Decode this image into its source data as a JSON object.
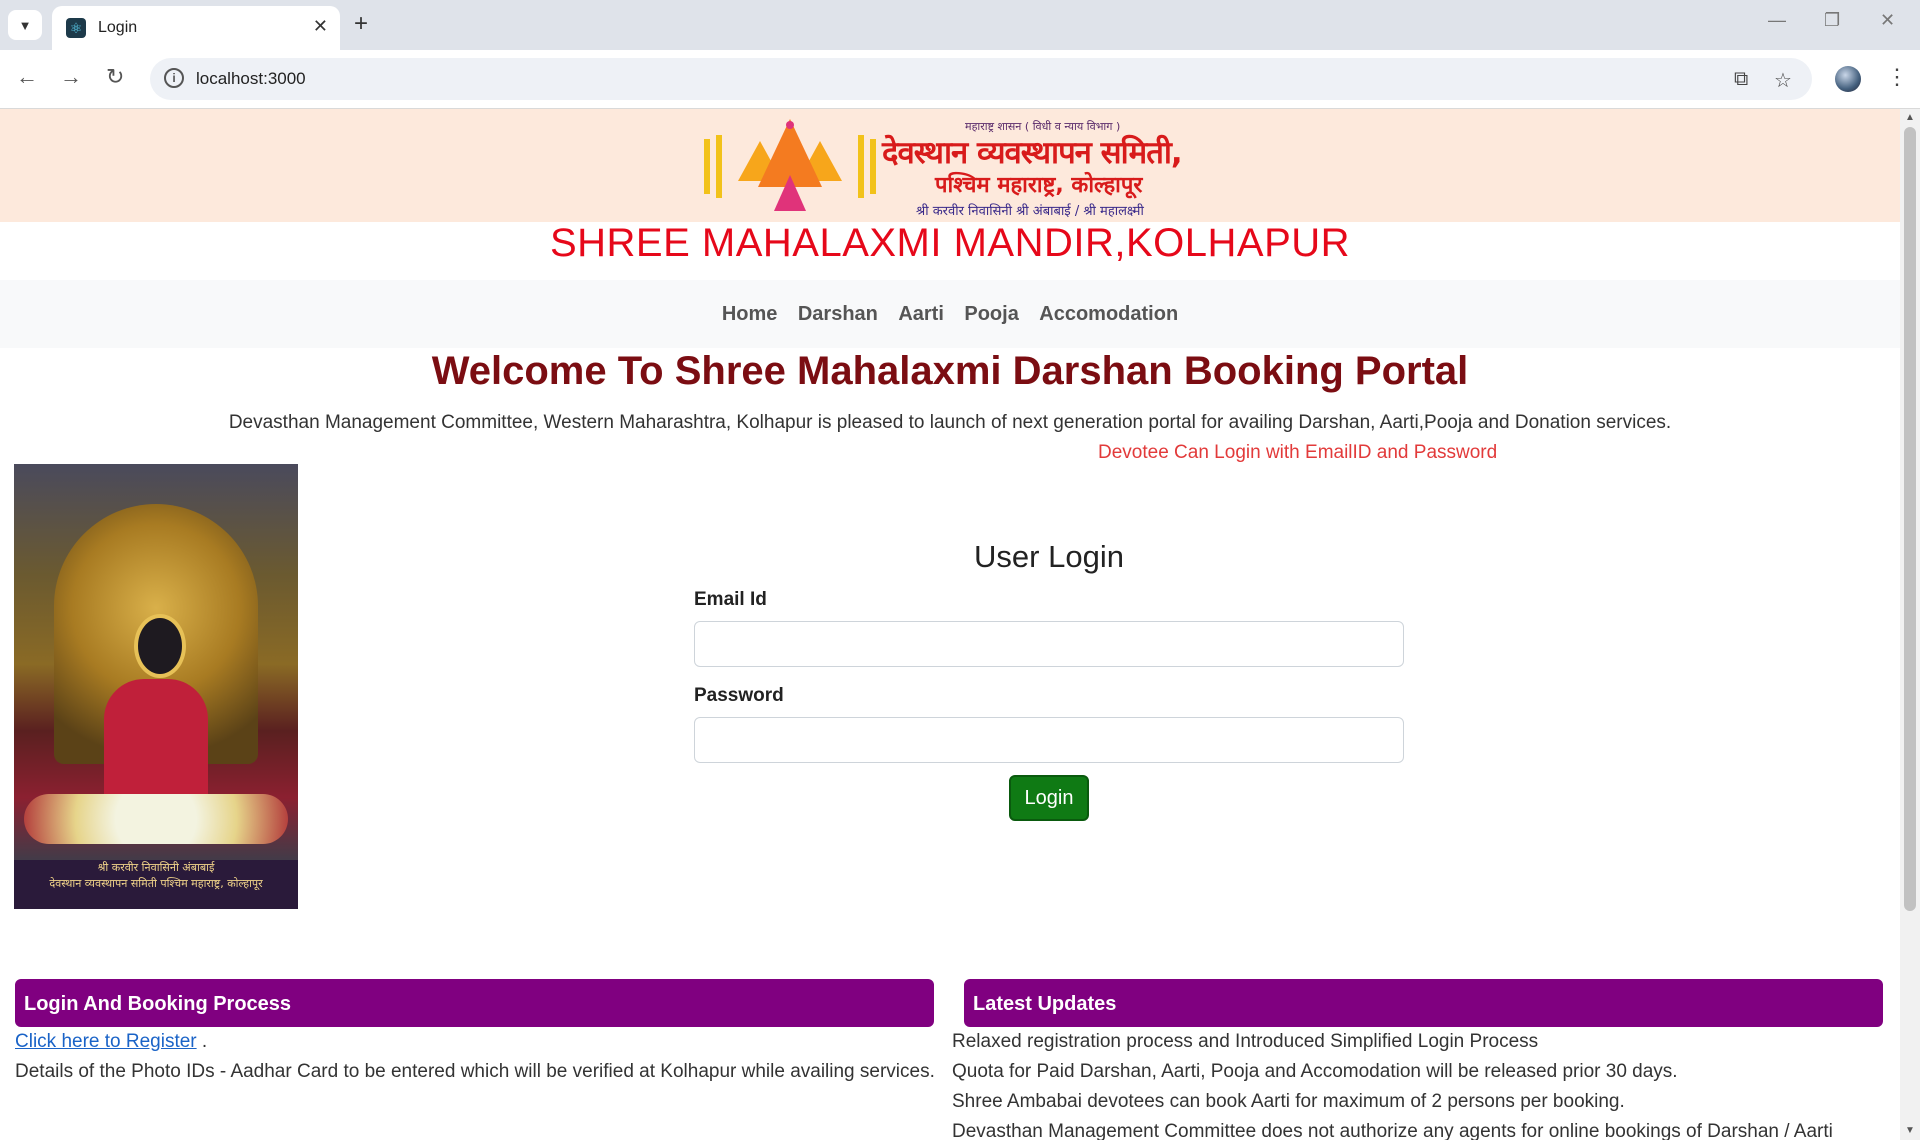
{
  "browser": {
    "tab_title": "Login",
    "url": "localhost:3000",
    "new_tab_glyph": "+",
    "close_glyph": "✕"
  },
  "banner": {
    "logo_small": "महाराष्ट्र शासन ( विधी व न्याय विभाग )",
    "logo_line1": "देवस्थान व्यवस्थापन समिती,",
    "logo_line2": "पश्चिम महाराष्ट्र, कोल्हापूर",
    "logo_line3": "श्री करवीर निवासिनी श्री अंबाबाई / श्री महालक्ष्मी",
    "site_title": "SHREE MAHALAXMI MANDIR,KOLHAPUR"
  },
  "nav": {
    "items": [
      "Home",
      "Darshan",
      "Aarti",
      "Pooja",
      "Accomodation"
    ]
  },
  "welcome": {
    "heading": "Welcome To Shree Mahalaxmi Darshan Booking Portal",
    "intro": "Devasthan Management Committee, Western Maharashtra, Kolhapur is pleased to launch of next generation portal for availing Darshan, Aarti,Pooja and Donation services.",
    "devotee_note": "Devotee Can Login with EmailID and Password"
  },
  "deity_image": {
    "caption_line1": "श्री करवीर निवासिनी अंबाबाई",
    "caption_line2": "देवस्थान व्यवस्थापन समिती पश्चिम महाराष्ट्र, कोल्हापूर"
  },
  "login": {
    "title": "User Login",
    "email_label": "Email Id",
    "email_value": "",
    "password_label": "Password",
    "password_value": "",
    "button_label": "Login"
  },
  "process_panel": {
    "title": "Login And Booking Process",
    "register_link": "Click here to Register",
    "register_suffix": " .",
    "details": "Details of the Photo IDs - Aadhar Card to be entered which will be verified at Kolhapur while availing services."
  },
  "updates_panel": {
    "title": "Latest Updates",
    "items": [
      " Relaxed registration process and Introduced Simplified Login Process",
      "Quota for Paid Darshan, Aarti, Pooja and Accomodation will be released prior 30 days.",
      "Shree Ambabai devotees can book Aarti for maximum of 2 persons per booking.",
      "Devasthan Management Committee does not authorize any agents for online bookings of Darshan / Aarti"
    ]
  },
  "colors": {
    "banner_bg": "#fde9dc",
    "site_title": "#e6081a",
    "welcome": "#7b0d12",
    "devotee_note": "#e23a3a",
    "panel_header": "#800080",
    "login_button": "#0f7a14"
  }
}
